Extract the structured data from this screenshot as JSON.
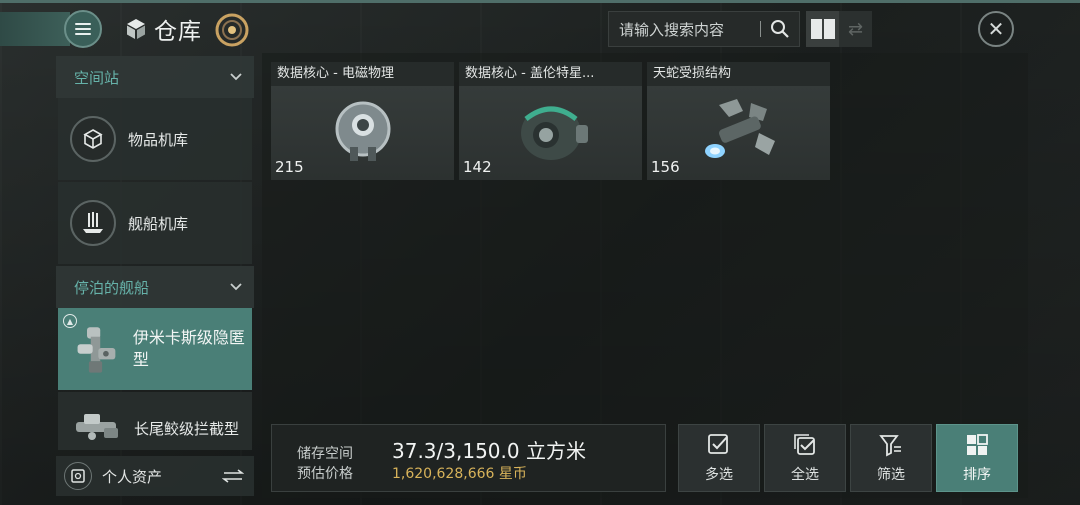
{
  "header": {
    "title": "仓库",
    "search_placeholder": "请输入搜索内容"
  },
  "sidebar": {
    "sections": [
      {
        "label": "空间站"
      },
      {
        "label": "停泊的舰船"
      }
    ],
    "items": [
      {
        "label": "物品机库",
        "icon": "cube-icon"
      },
      {
        "label": "舰船机库",
        "icon": "ship-hangar-icon"
      },
      {
        "label": "伊米卡斯级隐匿型",
        "icon": "ship-thumbnail",
        "active": true
      },
      {
        "label": "长尾鲛级拦截型",
        "icon": "ship-thumbnail"
      }
    ],
    "assets_label": "个人资产"
  },
  "items": [
    {
      "name": "数据核心 - 电磁物理",
      "quantity": "215",
      "icon": "data-core-icon"
    },
    {
      "name": "数据核心 - 盖伦特星...",
      "quantity": "142",
      "icon": "data-core-icon"
    },
    {
      "name": "天蛇受损结构",
      "quantity": "156",
      "icon": "damaged-structure-icon"
    }
  ],
  "storage": {
    "capacity_label": "储存空间",
    "capacity_value": "37.3/3,150.0 立方米",
    "price_label": "预估价格",
    "price_value": "1,620,628,666 星币"
  },
  "actions": [
    {
      "label": "多选",
      "icon": "check-box-icon"
    },
    {
      "label": "全选",
      "icon": "check-all-icon"
    },
    {
      "label": "筛选",
      "icon": "filter-icon"
    },
    {
      "label": "排序",
      "icon": "sort-grid-icon"
    }
  ],
  "colors": {
    "accent": "#4a7f77",
    "section_text": "#66b2a9",
    "price": "#d8b35a"
  }
}
